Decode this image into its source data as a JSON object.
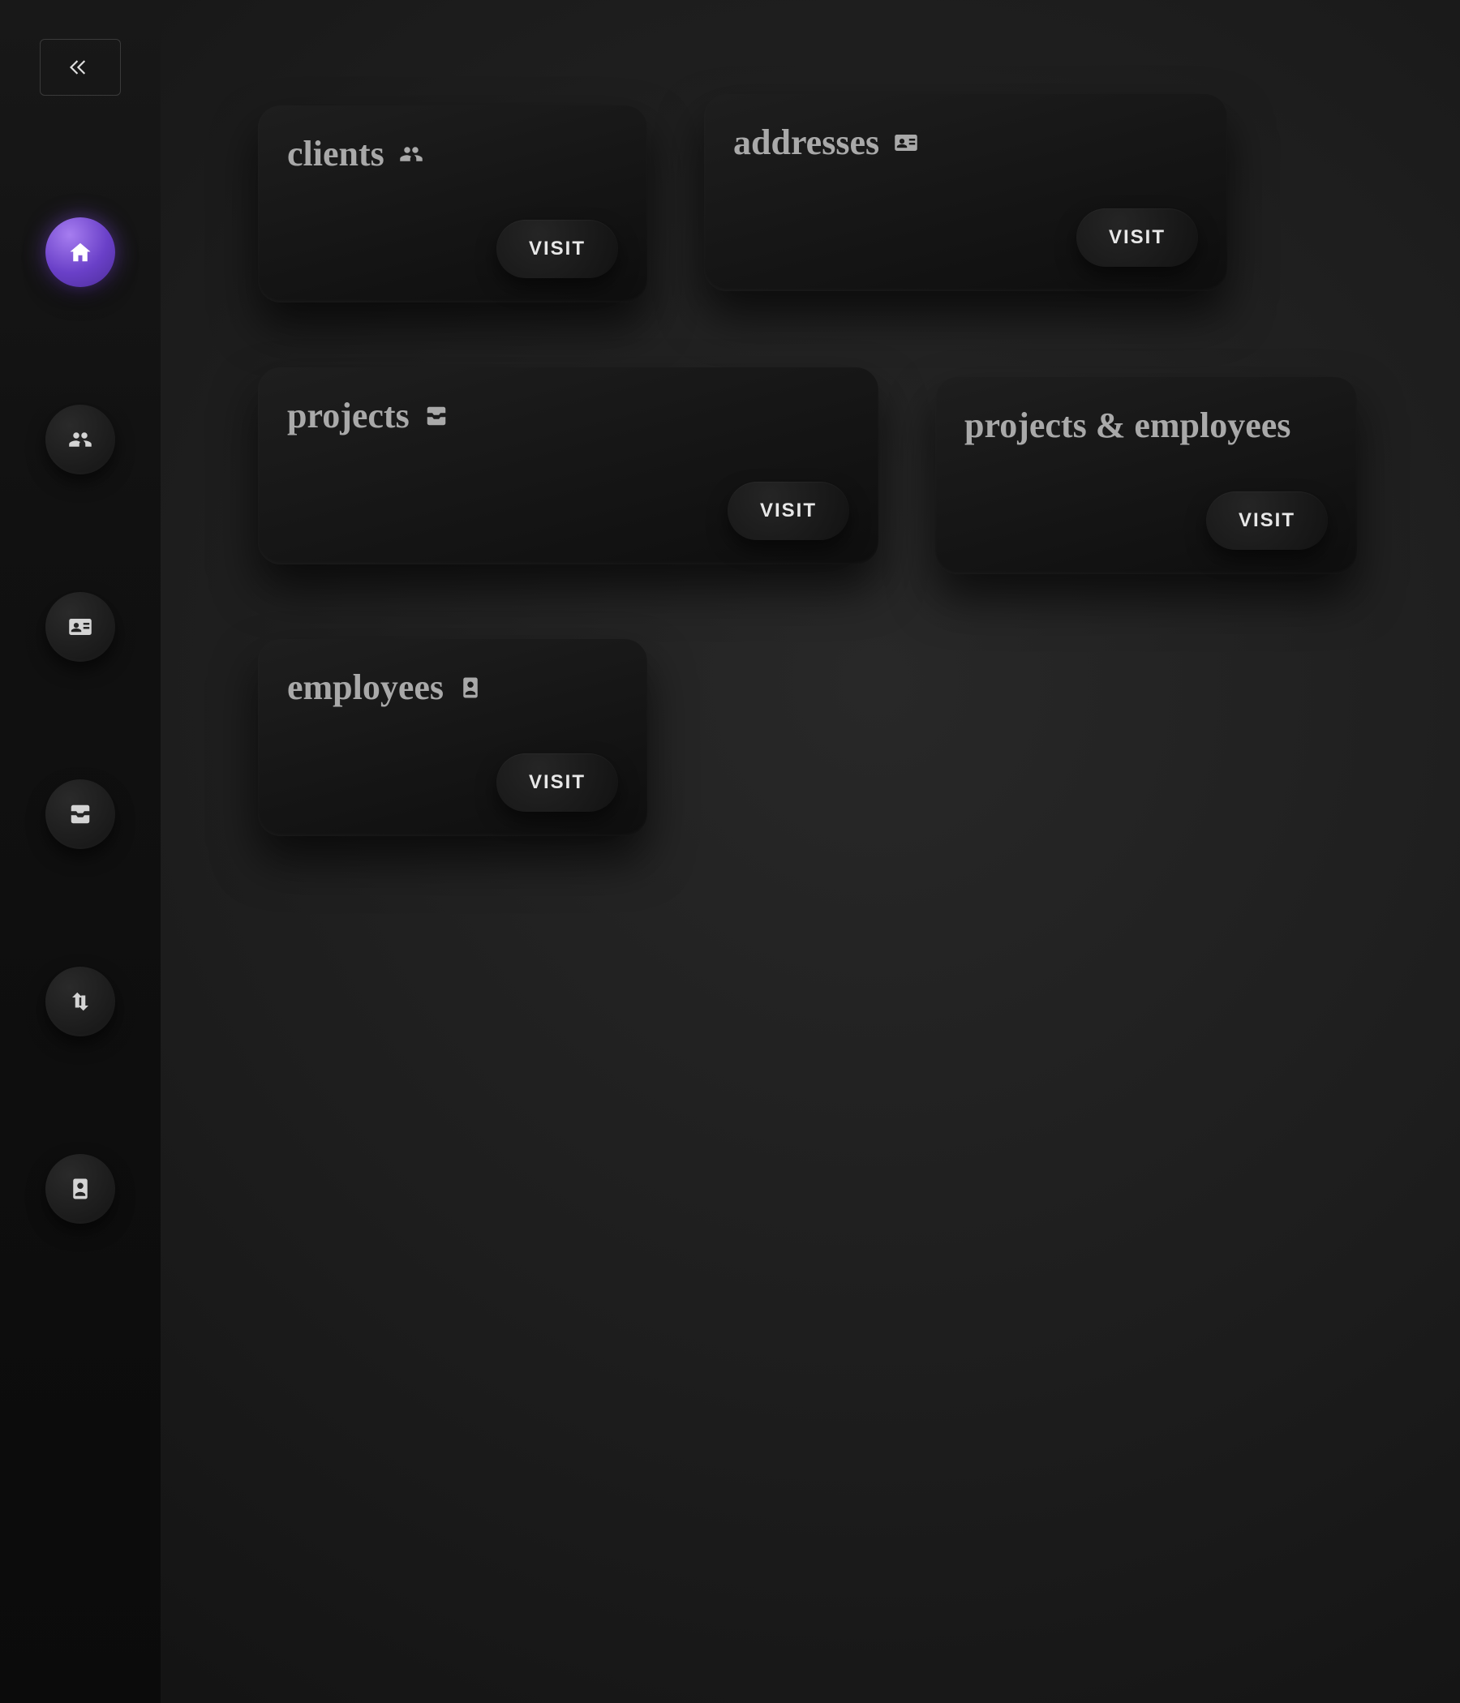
{
  "sidebar": {
    "collapse_label": "Collapse sidebar",
    "items": [
      {
        "name": "home",
        "active": true
      },
      {
        "name": "clients",
        "active": false
      },
      {
        "name": "addresses",
        "active": false
      },
      {
        "name": "projects",
        "active": false
      },
      {
        "name": "projects-employees",
        "active": false
      },
      {
        "name": "employees",
        "active": false
      }
    ]
  },
  "cards": {
    "clients": {
      "title": "clients",
      "button": "VISIT"
    },
    "addresses": {
      "title": "addresses",
      "button": "VISIT"
    },
    "projects": {
      "title": "projects",
      "button": "VISIT"
    },
    "projects_employees": {
      "title": "projects & employees",
      "button": "VISIT"
    },
    "employees": {
      "title": "employees",
      "button": "VISIT"
    }
  }
}
